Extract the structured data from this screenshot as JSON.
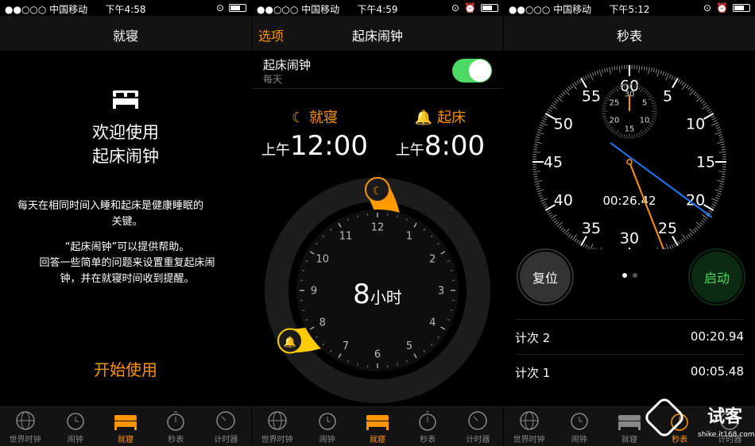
{
  "panel1": {
    "status": {
      "carrier": "●●○○○ 中国移动",
      "time": "下午4:58"
    },
    "title": "就寝",
    "welcome_line1": "欢迎使用",
    "welcome_line2": "起床闹钟",
    "desc_line1": "每天在相同时间入睡和起床是健康睡眠的",
    "desc_line2": "关键。",
    "help_line1": "“起床闹钟”可以提供帮助。",
    "help_line2": "回答一些简单的问题来设置重复起床闹",
    "help_line3": "钟，并在就寝时间收到提醒。",
    "start_label": "开始使用"
  },
  "panel2": {
    "status": {
      "carrier": "●●○○○ 中国移动",
      "time": "下午4:59"
    },
    "left_btn": "选项",
    "title": "起床闹钟",
    "toggle_label": "起床闹钟",
    "toggle_sub": "每天",
    "toggle_on": true,
    "bedtime_label": "就寝",
    "bedtime_ampm": "上午",
    "bedtime_time": "12:00",
    "wake_label": "起床",
    "wake_ampm": "上午",
    "wake_time": "8:00",
    "duration_num": "8",
    "duration_unit": "小时",
    "clock_numbers": [
      "12",
      "1",
      "2",
      "3",
      "4",
      "5",
      "6",
      "7",
      "8",
      "9",
      "10",
      "11"
    ]
  },
  "panel3": {
    "status": {
      "carrier": "●●○○○ 中国移动",
      "time": "下午5:12"
    },
    "title": "秒表",
    "dial_numbers": [
      "60",
      "5",
      "10",
      "15",
      "20",
      "25",
      "30",
      "35",
      "40",
      "45",
      "50",
      "55"
    ],
    "sub_dial_numbers": [
      "30",
      "5",
      "10",
      "15",
      "20",
      "25"
    ],
    "digital": "00:26.42",
    "reset_label": "复位",
    "start_label": "启动",
    "laps": [
      {
        "name": "计次 2",
        "time": "00:20.94"
      },
      {
        "name": "计次 1",
        "time": "00:05.48"
      }
    ]
  },
  "tabs": [
    "世界时钟",
    "闹钟",
    "就寝",
    "秒表",
    "计时器"
  ],
  "watermark": {
    "text": "试客",
    "url": "shike.it168.com"
  },
  "colors": {
    "accent": "#ff9500",
    "green": "#4cd964",
    "blue": "#1e7bff"
  }
}
